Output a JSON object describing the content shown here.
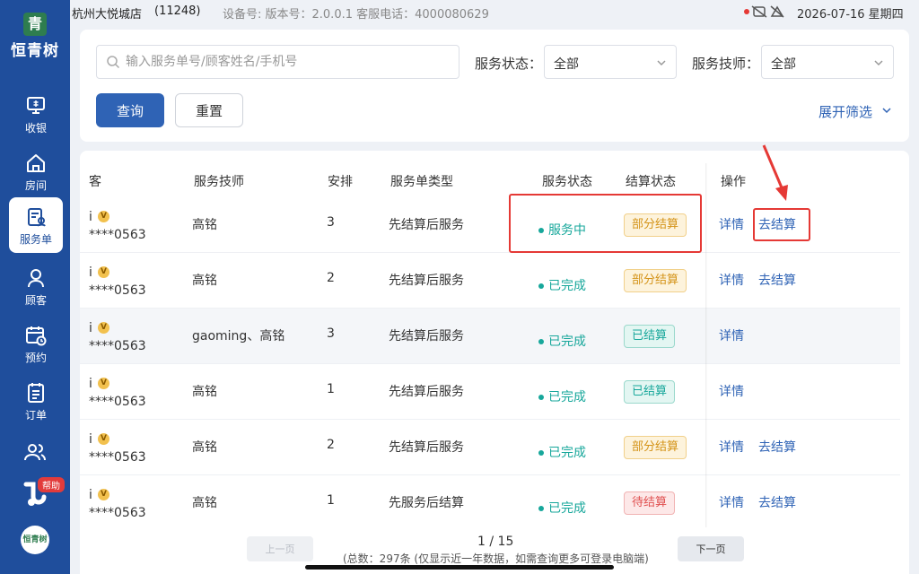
{
  "app": {
    "logo_text": "恒青树",
    "logo_mark": "青"
  },
  "sidebar": {
    "items": [
      {
        "label": "收银",
        "icon": "cashier-icon"
      },
      {
        "label": "房间",
        "icon": "room-icon"
      },
      {
        "label": "服务单",
        "icon": "service-order-icon",
        "active": true
      },
      {
        "label": "顾客",
        "icon": "customer-icon"
      },
      {
        "label": "预约",
        "icon": "appointment-icon"
      },
      {
        "label": "订单",
        "icon": "order-icon"
      }
    ],
    "help_label": "帮助",
    "brand_label": "恒青树"
  },
  "topbar": {
    "store_name": "杭州大悦城店",
    "store_code": "(11248)",
    "device_info": "设备号: 版本号：2.0.0.1  客服电话：4000080629",
    "datetime": "2026-07-16 星期四"
  },
  "filters": {
    "search_placeholder": "输入服务单号/顾客姓名/手机号",
    "status_label": "服务状态：",
    "status_value": "全部",
    "tech_label": "服务技师：",
    "tech_value": "全部",
    "query_button": "查询",
    "reset_button": "重置",
    "expand_label": "展开筛选"
  },
  "table": {
    "headers": {
      "customer": "客",
      "technician": "服务技师",
      "arrangement": "安排",
      "type": "服务单类型",
      "service_status": "服务状态",
      "settle_status": "结算状态",
      "actions": "操作"
    },
    "rows": [
      {
        "name": "i",
        "vip": "V",
        "phone": "****0563",
        "technician": "高铭",
        "arrangement": "3",
        "type": "先结算后服务",
        "service_status": "服务中",
        "settle_status": "部分结算",
        "settle_kind": "partial",
        "detail": "详情",
        "settle_action": "去结算"
      },
      {
        "name": "i",
        "vip": "V",
        "phone": "****0563",
        "technician": "高铭",
        "arrangement": "2",
        "type": "先结算后服务",
        "service_status": "已完成",
        "settle_status": "部分结算",
        "settle_kind": "partial",
        "detail": "详情",
        "settle_action": "去结算"
      },
      {
        "name": "i",
        "vip": "V",
        "phone": "****0563",
        "technician": "gaoming、高铭",
        "arrangement": "3",
        "type": "先结算后服务",
        "service_status": "已完成",
        "settle_status": "已结算",
        "settle_kind": "settled",
        "detail": "详情",
        "settle_action": ""
      },
      {
        "name": "i",
        "vip": "V",
        "phone": "****0563",
        "technician": "高铭",
        "arrangement": "1",
        "type": "先结算后服务",
        "service_status": "已完成",
        "settle_status": "已结算",
        "settle_kind": "settled",
        "detail": "详情",
        "settle_action": ""
      },
      {
        "name": "i",
        "vip": "V",
        "phone": "****0563",
        "technician": "高铭",
        "arrangement": "2",
        "type": "先结算后服务",
        "service_status": "已完成",
        "settle_status": "部分结算",
        "settle_kind": "partial",
        "detail": "详情",
        "settle_action": "去结算"
      },
      {
        "name": "i",
        "vip": "V",
        "phone": "****0563",
        "technician": "高铭",
        "arrangement": "1",
        "type": "先服务后结算",
        "service_status": "已完成",
        "settle_status": "待结算",
        "settle_kind": "pending",
        "detail": "详情",
        "settle_action": "去结算"
      }
    ]
  },
  "pagination": {
    "prev": "上一页",
    "next": "下一页",
    "current_page": "1",
    "separator": "/",
    "total_pages": "15",
    "total_note": "(总数：297条 (仅显示近一年数据，如需查询更多可登录电脑端)"
  },
  "colors": {
    "primary": "#2f63b5",
    "sidebar": "#1f4e9c",
    "highlight": "#e53935"
  }
}
